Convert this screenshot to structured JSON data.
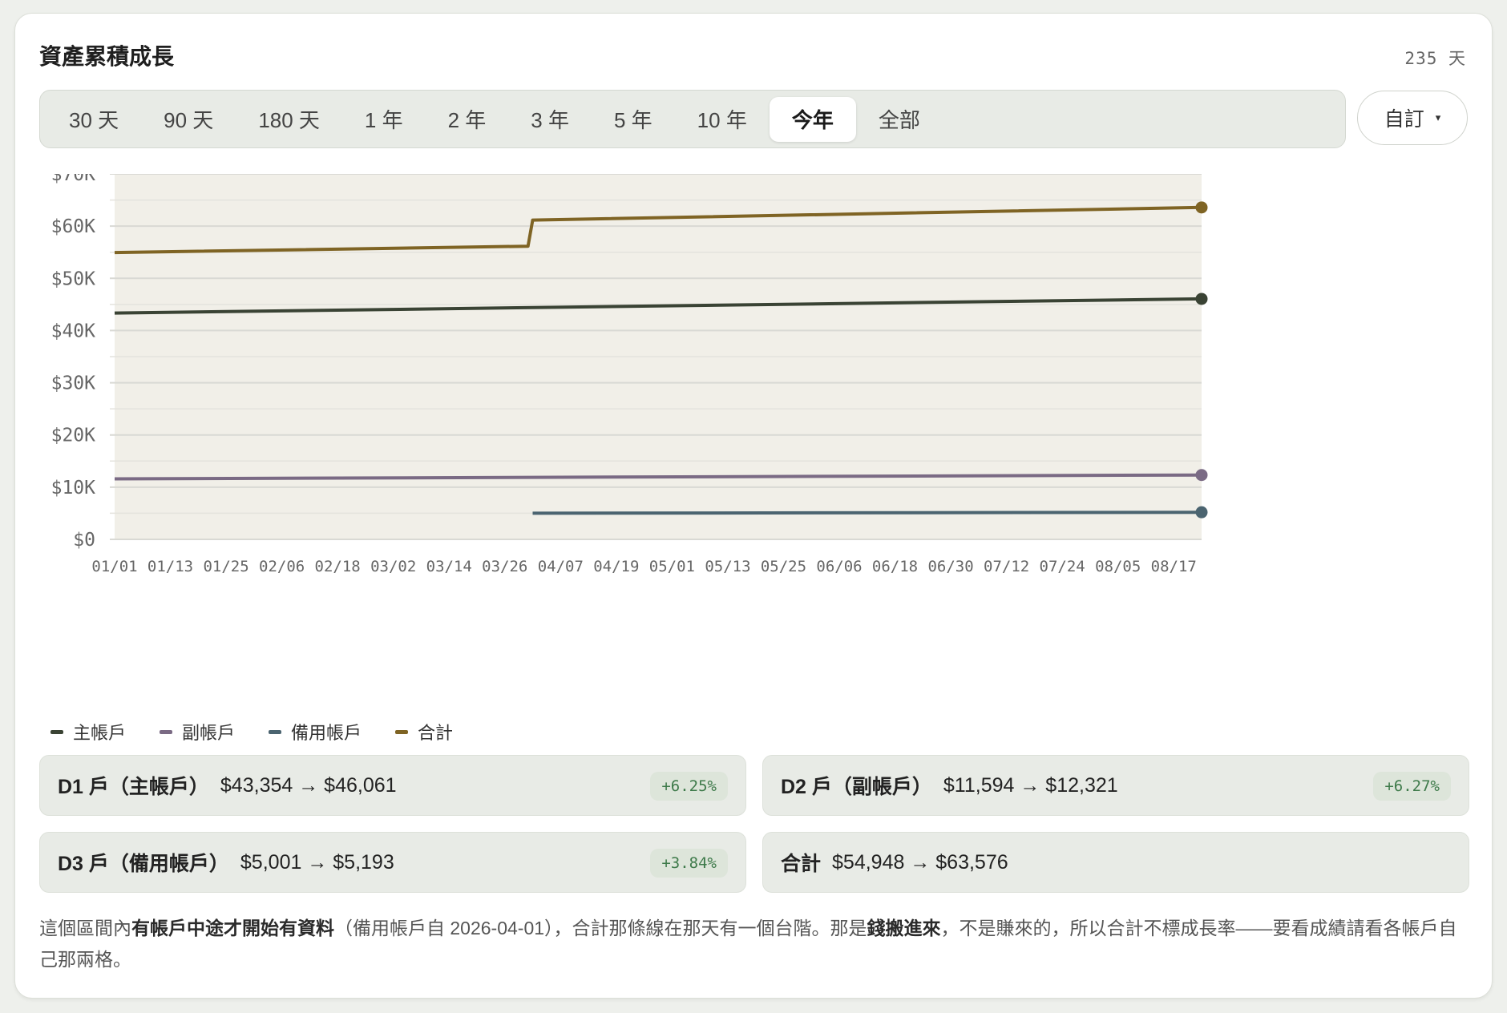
{
  "header": {
    "title": "資產累積成長",
    "days": "235 天"
  },
  "ranges": [
    {
      "label": "30 天",
      "active": false
    },
    {
      "label": "90 天",
      "active": false
    },
    {
      "label": "180 天",
      "active": false
    },
    {
      "label": "1 年",
      "active": false
    },
    {
      "label": "2 年",
      "active": false
    },
    {
      "label": "3 年",
      "active": false
    },
    {
      "label": "5 年",
      "active": false
    },
    {
      "label": "10 年",
      "active": false
    },
    {
      "label": "今年",
      "active": true
    },
    {
      "label": "全部",
      "active": false
    }
  ],
  "custom": {
    "label": "自訂",
    "caret": "▾"
  },
  "chart_data": {
    "type": "line",
    "x_ticks": [
      "01/01",
      "01/13",
      "01/25",
      "02/06",
      "02/18",
      "03/02",
      "03/14",
      "03/26",
      "04/07",
      "04/19",
      "05/01",
      "05/13",
      "05/25",
      "06/06",
      "06/18",
      "06/30",
      "07/12",
      "07/24",
      "08/05",
      "08/17"
    ],
    "x_range": [
      "01/01",
      "08/23"
    ],
    "y_ticks": [
      "$0",
      "$10K",
      "$20K",
      "$30K",
      "$40K",
      "$50K",
      "$60K",
      "$70K"
    ],
    "ylim": [
      0,
      70000
    ],
    "grid": true,
    "fill_area": true,
    "series": [
      {
        "name": "主帳戶",
        "color": "#3a4334",
        "points": [
          [
            "01/01",
            43354
          ],
          [
            "08/23",
            46061
          ]
        ]
      },
      {
        "name": "副帳戶",
        "color": "#7a6a84",
        "points": [
          [
            "01/01",
            11594
          ],
          [
            "08/23",
            12321
          ]
        ]
      },
      {
        "name": "備用帳戶",
        "color": "#4b6470",
        "points": [
          [
            "04/01",
            5001
          ],
          [
            "08/23",
            5193
          ]
        ]
      },
      {
        "name": "合計",
        "color": "#7f6424",
        "points": [
          [
            "01/01",
            54948
          ],
          [
            "03/31",
            56150
          ],
          [
            "04/01",
            61151
          ],
          [
            "08/23",
            63576
          ]
        ]
      }
    ]
  },
  "summary": [
    {
      "name": "D1 戶（主帳戶）",
      "change": "$43,354 → $46,061",
      "pct": "+6.25%"
    },
    {
      "name": "D2 戶（副帳戶）",
      "change": "$11,594 → $12,321",
      "pct": "+6.27%"
    },
    {
      "name": "D3 戶（備用帳戶）",
      "change": "$5,001 → $5,193",
      "pct": "+3.84%"
    },
    {
      "name": "合計",
      "change": "$54,948 → $63,576",
      "pct": ""
    }
  ],
  "note": {
    "p1": "這個區間內",
    "b1": "有帳戶中途才開始有資料",
    "p2": "（備用帳戶自 2026-04-01），合計那條線在那天有一個台階。那是",
    "b2": "錢搬進來",
    "p3": "，不是賺來的，所以合計不標成長率——要看成績請看各帳戶自己那兩格。"
  }
}
